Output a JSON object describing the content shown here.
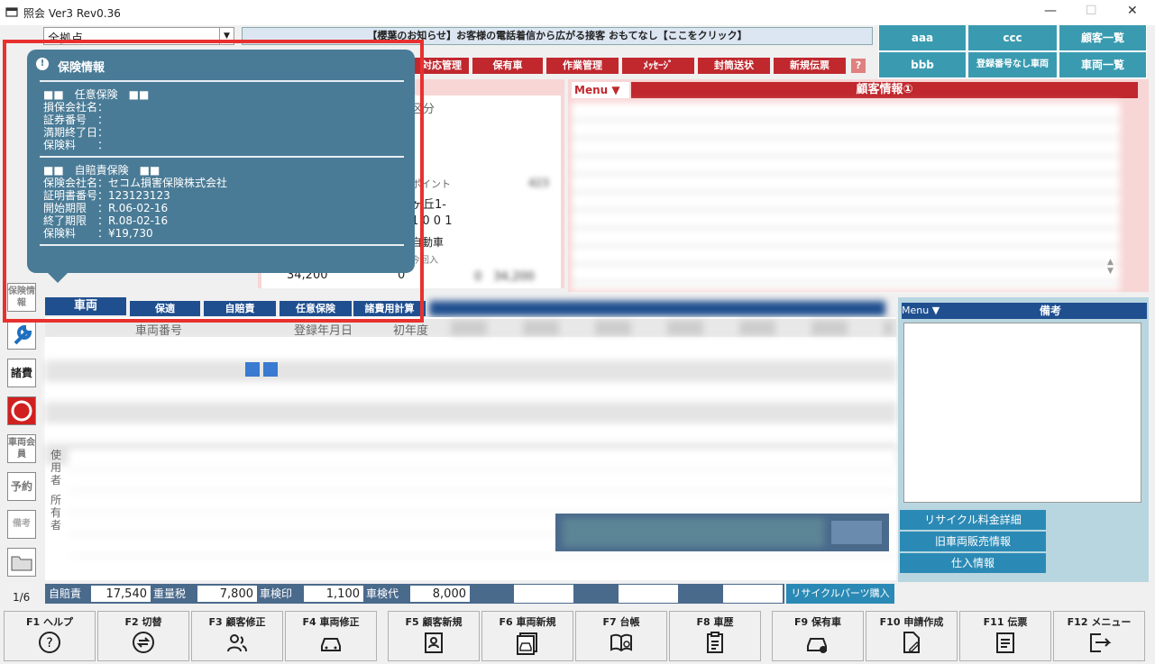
{
  "window": {
    "title": "照会 Ver3 Rev0.36",
    "page_indicator": "1/6"
  },
  "store_select": {
    "value": "全拠点"
  },
  "announcement": "【櫻葉のお知らせ】お客様の電話着信から広がる接客 おもてなし【ここをクリック】",
  "top_buttons": [
    "aaa",
    "ccc",
    "顧客一覧",
    "bbb",
    "登録番号なし車両",
    "車両一覧"
  ],
  "red_tabs": [
    "対応管理",
    "保有車",
    "作業管理",
    "ﾒｯｾｰｼﾞ",
    "封筒送状",
    "新規伝票",
    "?"
  ],
  "customer_panel": {
    "menu": "Menu ▼",
    "title": "顧客情報①"
  },
  "left_fields": [
    "区分",
    "ポイント",
    "ヶ丘1-",
    "1 0 0 1",
    "自動車",
    "今回入",
    "34,200",
    "0"
  ],
  "nav_tabs": [
    "車両",
    "保適",
    "自賠責",
    "任意保険",
    "諸費用計算"
  ],
  "vehicle_headers": [
    "車両番号",
    "登録年月日",
    "初年度"
  ],
  "owner_labels": [
    "使用者",
    "所有者"
  ],
  "side_buttons": [
    "保険情報",
    "諸費",
    "車両会員",
    "予約",
    "備考"
  ],
  "popup": {
    "title": "保険情報",
    "voluntary": {
      "header": "■■　任意保険　■■",
      "rows": [
        "損保会社名：",
        "証券番号　：",
        "満期終了日：",
        "保険料　　："
      ]
    },
    "compulsory": {
      "header": "■■　自賠責保険　■■",
      "rows": [
        "保険会社名：セコム損害保険株式会社",
        "証明書番号：123123123",
        "開始期限　：R.06-02-16",
        "終了期限　：R.08-02-16",
        "保険料　　：¥19,730"
      ]
    }
  },
  "right_panel": {
    "menu": "Menu ▼",
    "title": "備考",
    "buttons": [
      "リサイクル料金詳細",
      "旧車両販売情報",
      "仕入情報"
    ]
  },
  "cost_bar": {
    "items": [
      {
        "label": "自賠責",
        "value": "17,540"
      },
      {
        "label": "重量税",
        "value": "7,800"
      },
      {
        "label": "車検印",
        "value": "1,100"
      },
      {
        "label": "車検代",
        "value": "8,000"
      }
    ],
    "recycle_button": "リサイクルパーツ購入"
  },
  "fkeys": [
    {
      "label": "F1 ヘルプ",
      "icon": "help-icon"
    },
    {
      "label": "F2 切替",
      "icon": "switch-icon"
    },
    {
      "label": "F3 顧客修正",
      "icon": "users-icon"
    },
    {
      "label": "F4 車両修正",
      "icon": "car-icon"
    },
    {
      "label": "F5 顧客新規",
      "icon": "contact-icon"
    },
    {
      "label": "F6 車両新規",
      "icon": "car-new-icon"
    },
    {
      "label": "F7 台帳",
      "icon": "book-icon"
    },
    {
      "label": "F8 車歴",
      "icon": "clipboard-icon"
    },
    {
      "label": "F9 保有車",
      "icon": "car-lock-icon"
    },
    {
      "label": "F10 申請作成",
      "icon": "file-edit-icon"
    },
    {
      "label": "F11 伝票",
      "icon": "receipt-icon"
    },
    {
      "label": "F12 メニュー",
      "icon": "exit-icon"
    }
  ],
  "colors": {
    "highlight": "#e8312f",
    "popup_bg": "#4a7b96",
    "red_tab": "#c0282e",
    "teal": "#3a9bb0"
  }
}
